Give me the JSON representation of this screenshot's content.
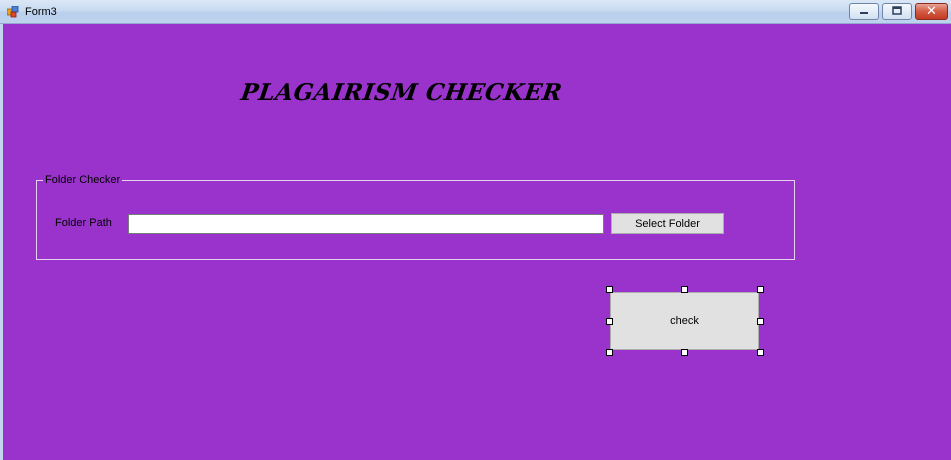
{
  "window": {
    "title": "Form3",
    "app_icon": "form-icon",
    "controls": {
      "minimize_icon": "minimize-icon",
      "maximize_icon": "maximize-icon",
      "close_icon": "close-icon",
      "close_glyph": "✕"
    }
  },
  "form": {
    "background_color": "#9933CC",
    "heading": "PLAGAIRISM CHECKER",
    "group": {
      "legend": "Folder Checker",
      "path_label": "Folder Path",
      "path_value": "",
      "select_button": "Select Folder"
    },
    "check_button": "check"
  }
}
